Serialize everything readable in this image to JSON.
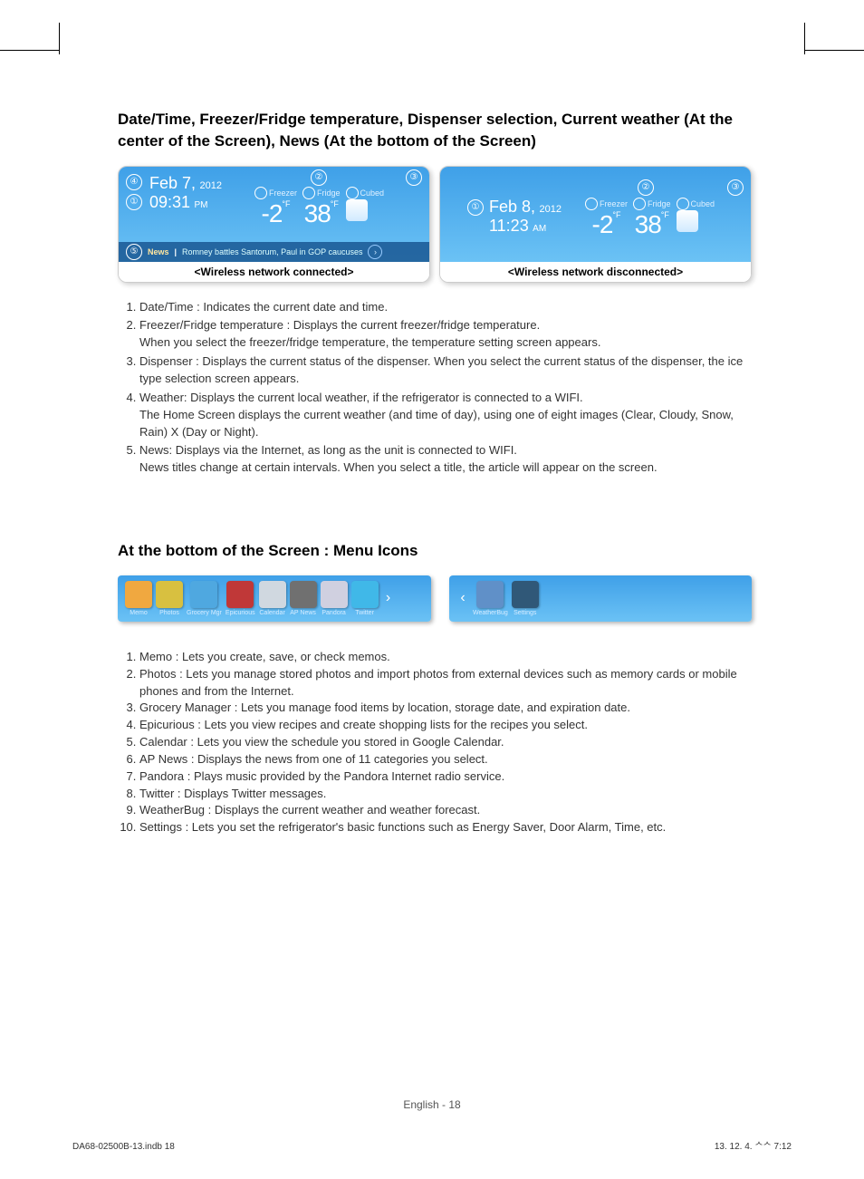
{
  "headings": {
    "section1": "Date/Time, Freezer/Fridge temperature, Dispenser selection, Current weather (At the center of the Screen), News (At the bottom of the Screen)",
    "section2": "At the bottom of the Screen : Menu Icons"
  },
  "panel1": {
    "caption": "<Wireless network connected>",
    "date": "Feb 7,",
    "year": "2012",
    "time": "09:31",
    "ampm": "PM",
    "freezer_label": "Freezer",
    "fridge_label": "Fridge",
    "cubed_label": "Cubed",
    "freezer_temp": "-2",
    "freezer_unit": "°F",
    "fridge_temp": "38",
    "fridge_unit": "°F",
    "news_label": "News",
    "news_text": "Romney battles Santorum, Paul in GOP caucuses",
    "callouts": {
      "c1": "①",
      "c2": "②",
      "c3": "③",
      "c4": "④",
      "c5": "⑤"
    }
  },
  "panel2": {
    "caption": "<Wireless network disconnected>",
    "date": "Feb 8,",
    "year": "2012",
    "time": "11:23",
    "ampm": "AM",
    "freezer_label": "Freezer",
    "fridge_label": "Fridge",
    "cubed_label": "Cubed",
    "freezer_temp": "-2",
    "freezer_unit": "°F",
    "fridge_temp": "38",
    "fridge_unit": "°F",
    "callouts": {
      "c1": "①",
      "c2": "②",
      "c3": "③"
    }
  },
  "list1": [
    "Date/Time : Indicates the current date and time.",
    "Freezer/Fridge temperature : Displays the current freezer/fridge temperature.\nWhen you select the freezer/fridge temperature, the temperature setting screen appears.",
    "Dispenser : Displays the current status of the dispenser. When you select the current status of the dispenser, the ice type selection screen appears.",
    "Weather:  Displays the current local weather, if the refrigerator is connected to a WIFI.\nThe Home Screen displays  the current weather (and time of day), using one of eight images (Clear, Cloudy, Snow, Rain) X (Day or Night).",
    "News:  Displays via the Internet, as long as the unit is connected to WIFI.\nNews titles change at certain intervals.  When you select a title, the article will appear on the screen."
  ],
  "menu": {
    "items1": [
      {
        "label": "Memo",
        "color": "#f0a840"
      },
      {
        "label": "Photos",
        "color": "#d8c040"
      },
      {
        "label": "Grocery Mgr",
        "color": "#4fa8e0"
      },
      {
        "label": "Epicurious",
        "color": "#c03838"
      },
      {
        "label": "Calendar",
        "color": "#d0d8e0"
      },
      {
        "label": "AP News",
        "color": "#707070"
      },
      {
        "label": "Pandora",
        "color": "#d0d0e0"
      },
      {
        "label": "Twitter",
        "color": "#40b8e8"
      }
    ],
    "items2": [
      {
        "label": "WeatherBug",
        "color": "#6090c8"
      },
      {
        "label": "Settings",
        "color": "#305878"
      }
    ]
  },
  "list2": [
    "Memo : Lets you create, save, or check memos.",
    "Photos : Lets you manage stored photos and import photos from external devices such as memory cards or mobile phones and from the Internet.",
    "Grocery Manager : Lets you manage food items by location, storage date, and expiration date.",
    "Epicurious : Lets you view recipes and create shopping lists for the recipes you select.",
    "Calendar : Lets you view the schedule you stored in Google Calendar.",
    "AP News : Displays the news from one of 11 categories you select.",
    "Pandora : Plays music provided by the Pandora Internet radio service.",
    "Twitter : Displays Twitter messages.",
    "WeatherBug : Displays the current weather and weather forecast.",
    "Settings : Lets you set the refrigerator's basic functions such as Energy Saver, Door Alarm, Time, etc."
  ],
  "footer": {
    "center": "English - 18",
    "left": "DA68-02500B-13.indb   18",
    "right": "13. 12. 4.   ᄉᄉ 7:12"
  }
}
